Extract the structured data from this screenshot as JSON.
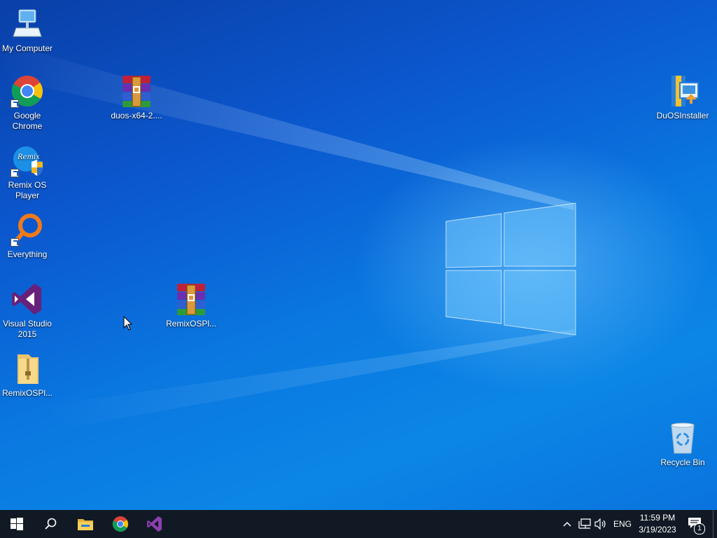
{
  "desktop": {
    "icons": [
      {
        "id": "my-computer",
        "label": "My Computer"
      },
      {
        "id": "google-chrome",
        "label": "Google Chrome"
      },
      {
        "id": "duos-archive",
        "label": "duos-x64-2...."
      },
      {
        "id": "duos-installer",
        "label": "DuOSInstaller"
      },
      {
        "id": "remix-os-player",
        "label": "Remix OS Player"
      },
      {
        "id": "everything",
        "label": "Everything"
      },
      {
        "id": "visual-studio",
        "label": "Visual Studio 2015"
      },
      {
        "id": "remix-archive",
        "label": "RemixOSPl..."
      },
      {
        "id": "remix-folder",
        "label": "RemixOSPl..."
      },
      {
        "id": "recycle-bin",
        "label": "Recycle Bin"
      }
    ]
  },
  "taskbar": {
    "pinned": [
      "start-icon",
      "search-icon",
      "file-explorer-icon",
      "chrome-icon",
      "visual-studio-icon"
    ],
    "language": "ENG",
    "time": "11:59 PM",
    "date": "3/19/2023",
    "notification_count": "1"
  },
  "colors": {
    "taskbar": "#111a24",
    "desktop_accent": "#0a78e0"
  }
}
